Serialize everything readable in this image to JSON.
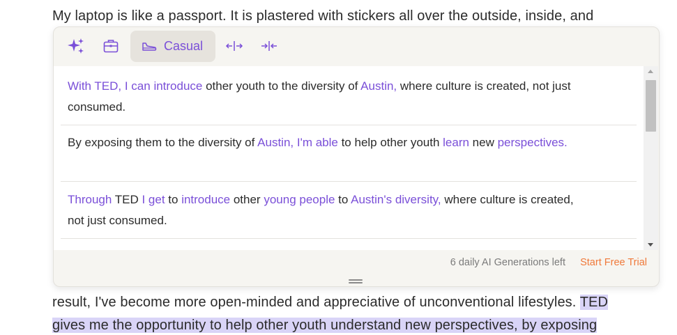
{
  "document": {
    "line1": "My laptop is like a passport. It is plastered with stickers all over the outside, inside, and",
    "line2_prefix": "result, I've become more open-minded and appreciative of unconventional lifestyles. ",
    "line2_highlight": "TED",
    "line3_highlight": "gives me the opportunity to help other youth understand new perspectives, by exposing"
  },
  "toolbar": {
    "sparkle_icon": "sparkle-icon",
    "formal_icon": "briefcase-icon",
    "tone_label": "Casual",
    "expand_icon": "expand-icon",
    "shorten_icon": "shorten-icon"
  },
  "suggestions": [
    {
      "segments": [
        {
          "t": "With TED, I can introduce",
          "c": true
        },
        {
          "t": " other youth to the diversity of ",
          "c": false
        },
        {
          "t": "Austin,",
          "c": true
        },
        {
          "t": " where culture is created, not just consumed.",
          "c": false
        }
      ]
    },
    {
      "segments": [
        {
          "t": "By exposing them to the diversity of ",
          "c": false
        },
        {
          "t": "Austin, I'm able",
          "c": true
        },
        {
          "t": " to help other youth ",
          "c": false
        },
        {
          "t": "learn",
          "c": true
        },
        {
          "t": " new ",
          "c": false
        },
        {
          "t": "perspectives.",
          "c": true
        }
      ]
    },
    {
      "segments": [
        {
          "t": "Through",
          "c": true
        },
        {
          "t": " TED ",
          "c": false
        },
        {
          "t": "I get",
          "c": true
        },
        {
          "t": " to ",
          "c": false
        },
        {
          "t": "introduce",
          "c": true
        },
        {
          "t": " other ",
          "c": false
        },
        {
          "t": "young people",
          "c": true
        },
        {
          "t": " to ",
          "c": false
        },
        {
          "t": "Austin's diversity,",
          "c": true
        },
        {
          "t": " where culture is created, not just consumed.",
          "c": false
        }
      ]
    }
  ],
  "footer": {
    "generations_left": "6 daily AI Generations left",
    "trial_link": "Start Free Trial"
  },
  "colors": {
    "accent": "#7a4fd8",
    "trial": "#f0793a",
    "highlight": "#d9d4f7"
  }
}
